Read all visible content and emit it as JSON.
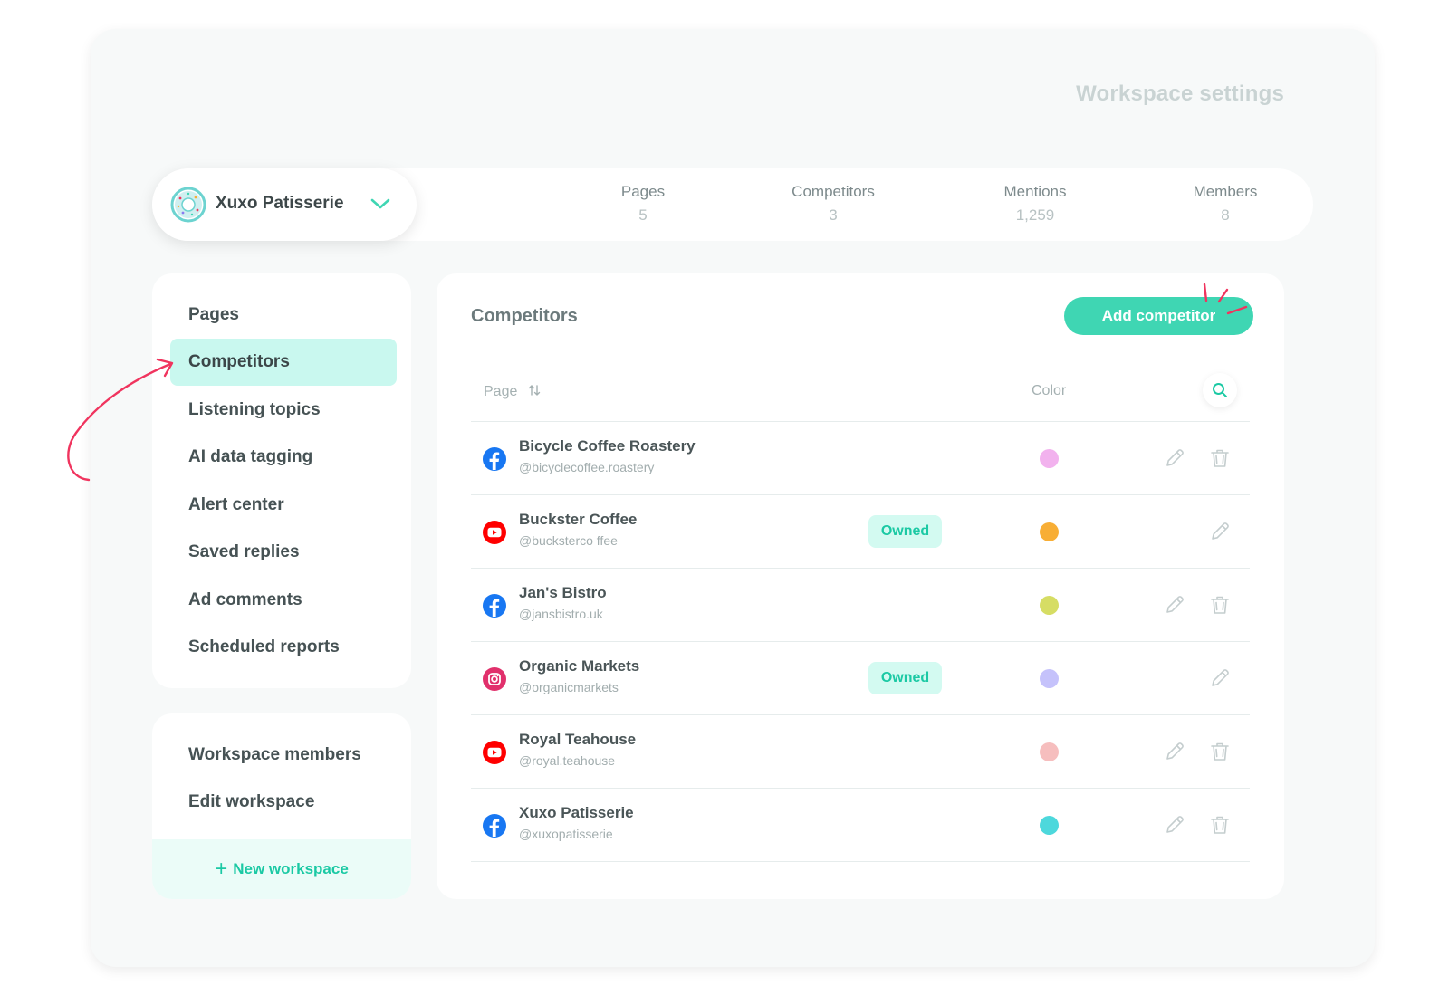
{
  "header": {
    "title": "Workspace settings"
  },
  "workspace": {
    "name": "Xuxo Patisserie",
    "logo": "donut-logo-icon"
  },
  "stats": [
    {
      "label": "Pages",
      "value": "5"
    },
    {
      "label": "Competitors",
      "value": "3"
    },
    {
      "label": "Mentions",
      "value": "1,259"
    },
    {
      "label": "Members",
      "value": "8"
    }
  ],
  "sidebar": {
    "items": [
      {
        "label": "Pages",
        "active": false
      },
      {
        "label": "Competitors",
        "active": true
      },
      {
        "label": "Listening topics",
        "active": false
      },
      {
        "label": "AI data tagging",
        "active": false
      },
      {
        "label": "Alert center",
        "active": false
      },
      {
        "label": "Saved replies",
        "active": false
      },
      {
        "label": "Ad comments",
        "active": false
      },
      {
        "label": "Scheduled reports",
        "active": false
      }
    ],
    "secondary": [
      {
        "label": "Workspace members"
      },
      {
        "label": "Edit workspace"
      }
    ],
    "new_workspace": "New workspace"
  },
  "panel": {
    "title": "Competitors",
    "add_button": "Add competitor",
    "columns": {
      "page": "Page",
      "color": "Color"
    },
    "rows": [
      {
        "network": "facebook-icon",
        "name": "Bicycle Coffee Roastery",
        "handle": "@bicyclecoffee.roastery",
        "owned": "",
        "color": "#f2b2ee"
      },
      {
        "network": "youtube-icon",
        "name": "Buckster Coffee",
        "handle": "@bucksterco ffee",
        "owned": "Owned",
        "color": "#f8ae35"
      },
      {
        "network": "facebook-icon",
        "name": "Jan's Bistro",
        "handle": "@jansbistro.uk",
        "owned": "",
        "color": "#d6dd64"
      },
      {
        "network": "instagram-icon",
        "name": "Organic Markets",
        "handle": "@organicmarkets",
        "owned": "Owned",
        "color": "#c5c2fb"
      },
      {
        "network": "youtube-icon",
        "name": "Royal Teahouse",
        "handle": "@royal.teahouse",
        "owned": "",
        "color": "#f6bebe"
      },
      {
        "network": "facebook-icon",
        "name": "Xuxo Patisserie",
        "handle": "@xuxopatisserie",
        "owned": "",
        "color": "#4dd8dc"
      }
    ]
  },
  "colors": {
    "accent": "#3fd6b3",
    "annotation": "#f0345e"
  }
}
